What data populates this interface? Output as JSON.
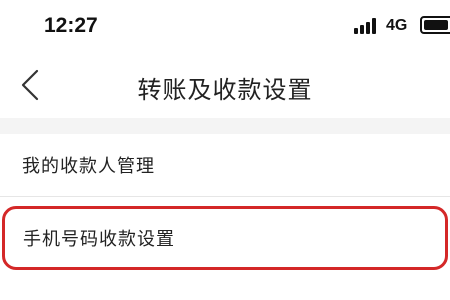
{
  "status_bar": {
    "time": "12:27",
    "network": "4G",
    "signal_icon": "signal-bars-icon",
    "battery_icon": "battery-icon"
  },
  "nav": {
    "back_icon": "chevron-left-icon",
    "title": "转账及收款设置"
  },
  "list": {
    "items": [
      {
        "label": "我的收款人管理"
      },
      {
        "label": "手机号码收款设置",
        "highlight_color": "#d42828"
      }
    ]
  },
  "colors": {
    "page_background": "#f4f4f4",
    "highlight": "#d42828"
  }
}
